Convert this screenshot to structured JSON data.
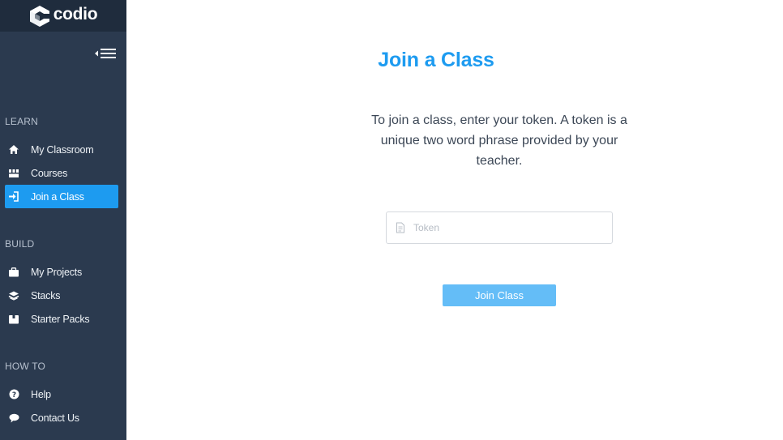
{
  "app": {
    "logo_text": "codio"
  },
  "sidebar": {
    "sections": [
      {
        "title": "LEARN",
        "items": [
          {
            "label": "My Classroom",
            "icon": "home-icon"
          },
          {
            "label": "Courses",
            "icon": "courses-icon"
          },
          {
            "label": "Join a Class",
            "icon": "sign-in-icon",
            "active": true
          }
        ]
      },
      {
        "title": "BUILD",
        "items": [
          {
            "label": "My Projects",
            "icon": "briefcase-icon"
          },
          {
            "label": "Stacks",
            "icon": "layers-icon"
          },
          {
            "label": "Starter Packs",
            "icon": "package-icon"
          }
        ]
      },
      {
        "title": "HOW TO",
        "items": [
          {
            "label": "Help",
            "icon": "question-circle-icon"
          },
          {
            "label": "Contact Us",
            "icon": "chat-bubble-icon"
          }
        ]
      }
    ]
  },
  "main": {
    "title": "Join a Class",
    "intro": "To join a class, enter your token. A token is a unique two word phrase provided by your teacher.",
    "token_field": {
      "placeholder": "Token",
      "value": ""
    },
    "join_button": "Join Class"
  },
  "colors": {
    "accent": "#1d9bf0",
    "sidebar_bg": "#2b3a4f",
    "logo_bar_bg": "#1f2c3d",
    "button_bg": "#64bdf7"
  }
}
